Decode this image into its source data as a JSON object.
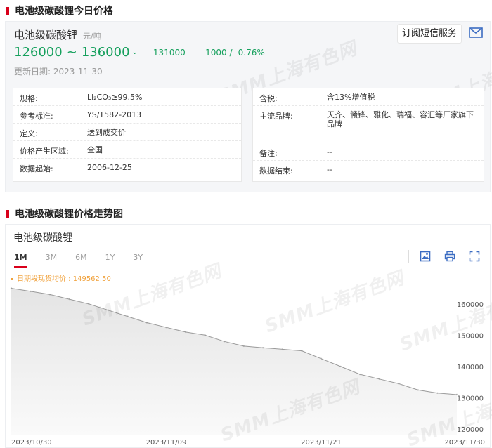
{
  "section1": {
    "title": "电池级碳酸锂今日价格"
  },
  "product": {
    "name": "电池级碳酸锂",
    "unit": "元/吨",
    "price_low": "126000",
    "price_sep": "~",
    "price_high": "136000",
    "avg": "131000",
    "change": "-1000",
    "change_sep": "/",
    "change_pct": "-0.76%",
    "update_label": "更新日期:",
    "update_date": "2023-11-30",
    "subscribe_label": "订阅短信服务"
  },
  "specs_left": [
    {
      "key": "规格:",
      "value": "Li₂CO₃≥99.5%"
    },
    {
      "key": "参考标准:",
      "value": "YS/T582-2013"
    },
    {
      "key": "定义:",
      "value": "送到成交价"
    },
    {
      "key": "价格产生区域:",
      "value": "全国"
    },
    {
      "key": "数据起始:",
      "value": "2006-12-25"
    }
  ],
  "specs_right": [
    {
      "key": "含税:",
      "value": "含13%增值税"
    },
    {
      "key": "主流品牌:",
      "value": "天齐、赣锋、雅化、瑞福、容汇等厂家旗下品牌"
    },
    {
      "key": "备注:",
      "value": "--"
    },
    {
      "key": "数据结束:",
      "value": "--"
    }
  ],
  "watermark": "SMM上海有色网",
  "section2": {
    "title": "电池级碳酸锂价格走势图"
  },
  "chart": {
    "title": "电池级碳酸锂",
    "tabs": [
      "1M",
      "3M",
      "6M",
      "1Y",
      "3Y"
    ],
    "active_tab": "1M",
    "legend_label": "日期段现货均价 : 149562.50",
    "icons": [
      "image-download-icon",
      "print-icon",
      "fullscreen-icon"
    ]
  },
  "chart_data": {
    "type": "area",
    "x": [
      "2023/10/30",
      "2023/10/31",
      "2023/11/01",
      "2023/11/02",
      "2023/11/03",
      "2023/11/06",
      "2023/11/07",
      "2023/11/08",
      "2023/11/09",
      "2023/11/10",
      "2023/11/13",
      "2023/11/14",
      "2023/11/15",
      "2023/11/16",
      "2023/11/17",
      "2023/11/20",
      "2023/11/21",
      "2023/11/22",
      "2023/11/23",
      "2023/11/24",
      "2023/11/27",
      "2023/11/28",
      "2023/11/29",
      "2023/11/30"
    ],
    "values": [
      165000,
      164000,
      163000,
      161500,
      160000,
      158000,
      156000,
      154000,
      152500,
      151000,
      150000,
      148000,
      146500,
      146000,
      145500,
      145000,
      142500,
      140000,
      137500,
      136000,
      134500,
      132500,
      131500,
      131000
    ],
    "xtick_labels": [
      "2023/10/30",
      "2023/11/09",
      "2023/11/21",
      "2023/11/30"
    ],
    "ytick_values": [
      120000,
      130000,
      140000,
      150000,
      160000
    ],
    "ylim": [
      118000,
      166000
    ],
    "line_color": "#9a9a9a",
    "fill_color": "#e4e4e4"
  },
  "colors": {
    "accent_red": "#d9001b",
    "price_green": "#16a05d",
    "legend_orange": "#f0a13b"
  }
}
